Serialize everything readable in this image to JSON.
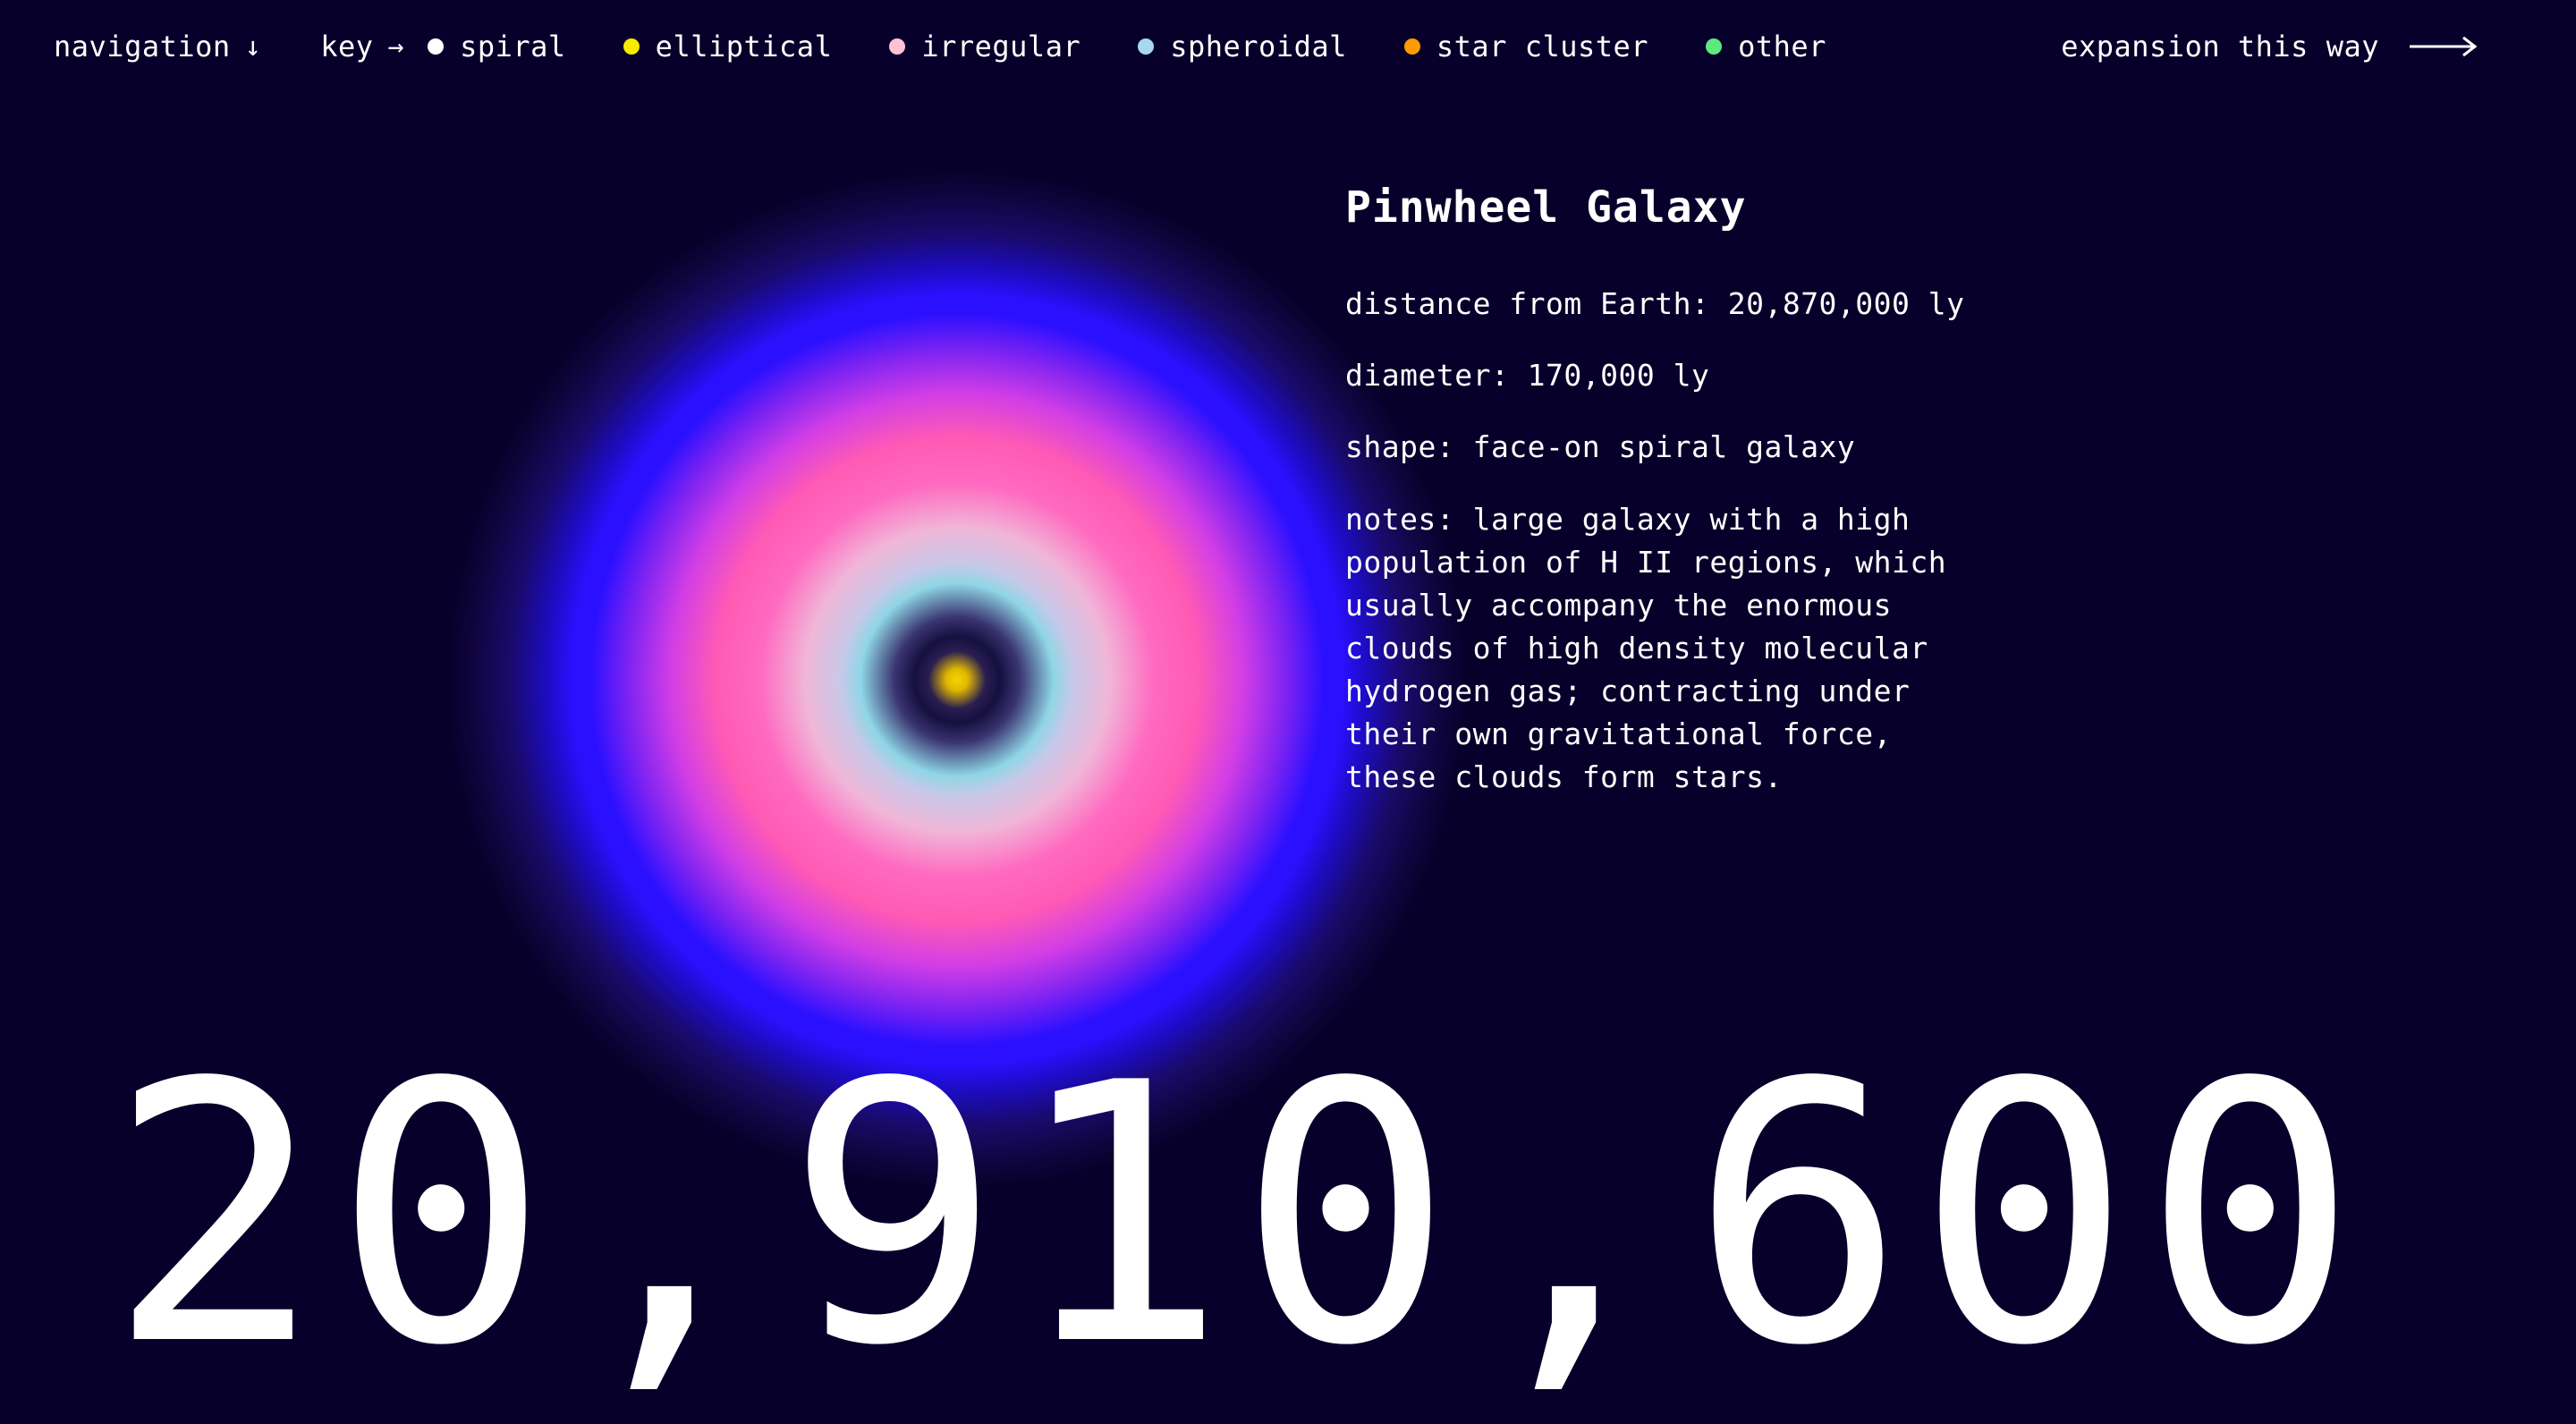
{
  "nav": {
    "navigation_label": "navigation",
    "navigation_arrow": "↓",
    "key_label": "key",
    "key_arrow": "→"
  },
  "legend": [
    {
      "label": "spiral",
      "color": "#ffffff"
    },
    {
      "label": "elliptical",
      "color": "#f5ec00"
    },
    {
      "label": "irregular",
      "color": "#ffc2d4"
    },
    {
      "label": "spheroidal",
      "color": "#a8d8ec"
    },
    {
      "label": "star cluster",
      "color": "#ff9a00"
    },
    {
      "label": "other",
      "color": "#5ee880"
    }
  ],
  "expansion": {
    "label": "expansion this way",
    "icon": "long-arrow-right-icon"
  },
  "galaxy": {
    "name": "Pinwheel Galaxy",
    "distance_line": "distance from Earth: 20,870,000 ly",
    "diameter_line": "diameter: 170,000 ly",
    "shape_line": "shape: face-on spiral galaxy",
    "notes": "notes: large galaxy with a high population of H II regions, which usually accompany the enormous clouds of high density molecular hydrogen gas; contracting under their own gravitational force, these clouds form stars.",
    "type": "spiral"
  },
  "counter": {
    "value": "20,910,600"
  },
  "colors": {
    "background": "#07002a",
    "text": "#ffffff"
  }
}
